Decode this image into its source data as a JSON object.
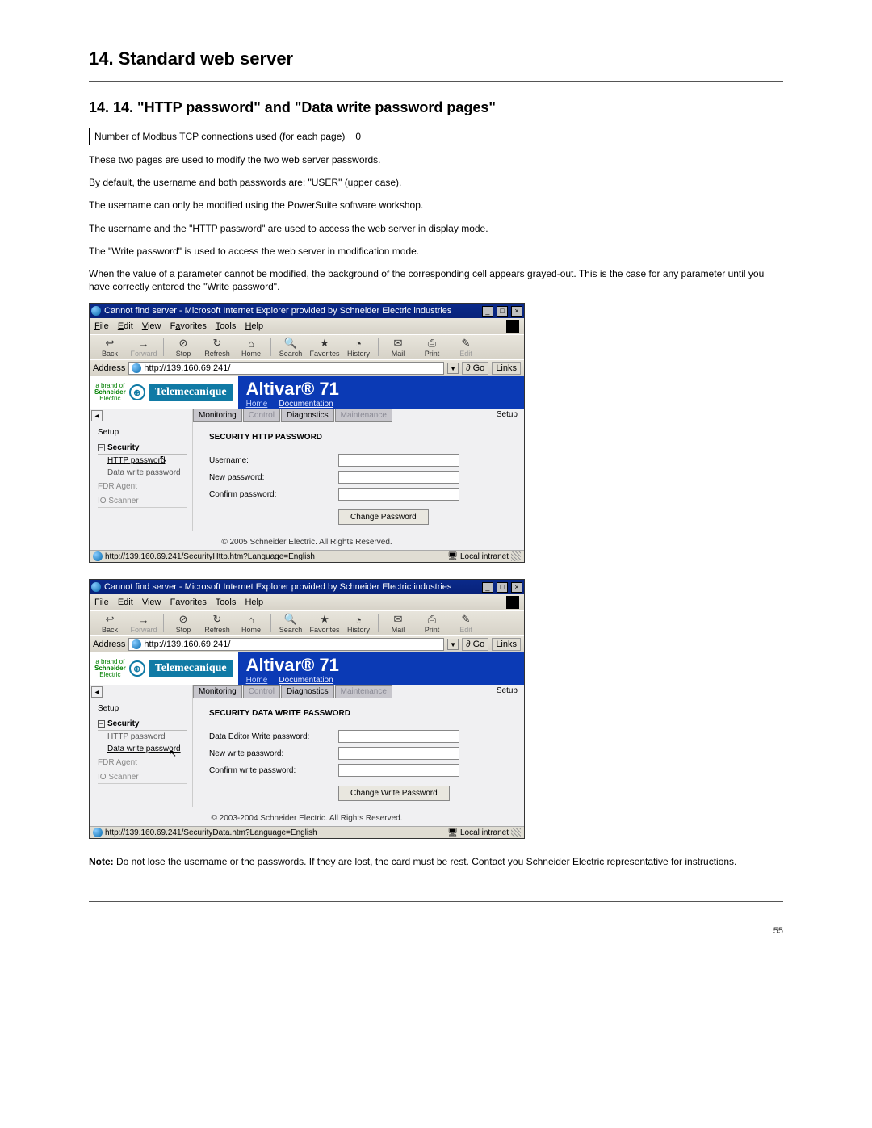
{
  "heading": "14. Standard web server",
  "subheading": "14. 14. \"HTTP password\" and \"Data write password pages\"",
  "tcp_row": {
    "label": "Number of Modbus TCP connections used (for each page)",
    "value": "0"
  },
  "paragraphs": [
    "These two pages are used to modify the two web server passwords.",
    "By default, the username and both passwords are: \"USER\" (upper case).",
    "The username can only be modified using the PowerSuite software workshop.",
    "The username and the \"HTTP password\" are used to access the web server in display mode.",
    "The \"Write password\" is used to access the web server in modification mode.",
    "When the value of a parameter cannot be modified, the background of the corresponding cell appears grayed-out. This is the case for any parameter until you have correctly entered the \"Write password\"."
  ],
  "ie": {
    "title": "Cannot find server - Microsoft Internet Explorer provided by Schneider Electric industries",
    "menu": {
      "file": "File",
      "edit": "Edit",
      "view": "View",
      "favorites": "Favorites",
      "tools": "Tools",
      "help": "Help"
    },
    "tb": {
      "back": "Back",
      "forward": "Forward",
      "stop": "Stop",
      "refresh": "Refresh",
      "home": "Home",
      "search": "Search",
      "favorites": "Favorites",
      "history": "History",
      "mail": "Mail",
      "print": "Print",
      "edit": "Edit"
    },
    "addr_label": "Address",
    "url": "http://139.160.69.241/",
    "go": "Go",
    "links": "Links",
    "status_zone": "Local intranet"
  },
  "brand": {
    "schneider": "a brand of\nSchneider\nElectric",
    "tele": "Telemecanique",
    "product": "Altivar® 71",
    "home": "Home",
    "doc": "Documentation",
    "tabs": {
      "monitoring": "Monitoring",
      "control": "Control",
      "diagnostics": "Diagnostics",
      "maintenance": "Maintenance"
    },
    "setup": "Setup"
  },
  "fig1": {
    "title": "SECURITY HTTP PASSWORD",
    "sidebar": {
      "group": "Security",
      "http": "HTTP password",
      "data": "Data write password",
      "fdr": "FDR Agent",
      "io": "IO Scanner"
    },
    "fields": {
      "user": "Username:",
      "newp": "New password:",
      "conf": "Confirm password:"
    },
    "button": "Change Password",
    "copy": "© 2005 Schneider Electric. All Rights Reserved.",
    "status": "http://139.160.69.241/SecurityHttp.htm?Language=English"
  },
  "fig2": {
    "title": "SECURITY DATA WRITE PASSWORD",
    "sidebar": {
      "group": "Security",
      "http": "HTTP password",
      "data": "Data write password",
      "fdr": "FDR Agent",
      "io": "IO Scanner"
    },
    "fields": {
      "dep": "Data Editor Write password:",
      "newp": "New write password:",
      "conf": "Confirm write password:"
    },
    "button": "Change Write Password",
    "copy": "© 2003-2004 Schneider Electric. All Rights Reserved.",
    "status": "http://139.160.69.241/SecurityData.htm?Language=English"
  },
  "note_label": "Note:",
  "note": " Do not lose the username or the passwords. If they are lost, the card must be rest. Contact you Schneider Electric representative for instructions.",
  "page_num": "55"
}
